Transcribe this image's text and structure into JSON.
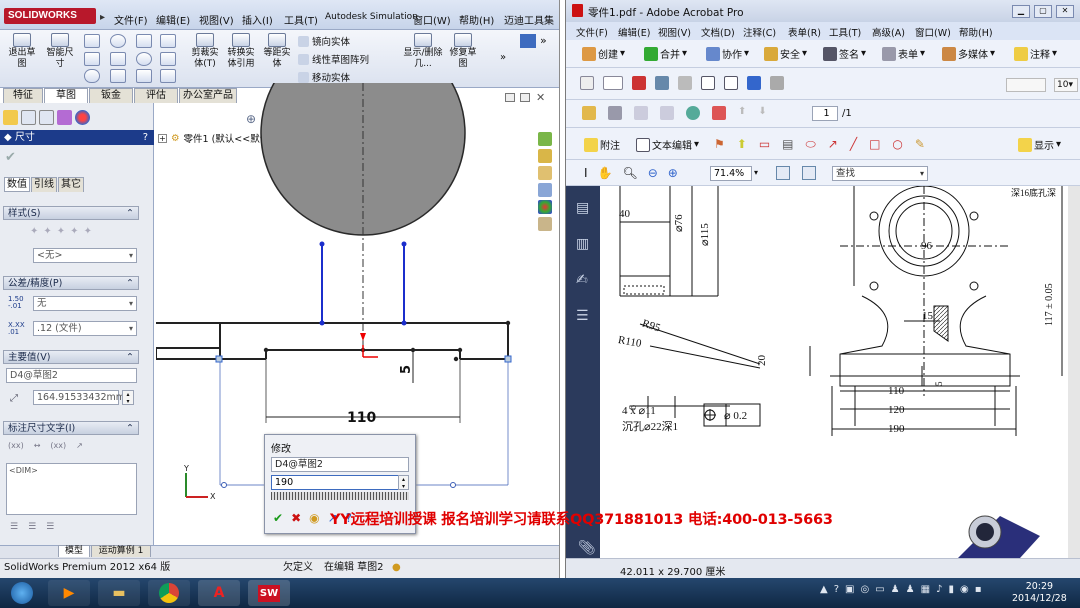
{
  "sw": {
    "app_name": "SOLIDWORKS",
    "menu": [
      "文件(F)",
      "编辑(E)",
      "视图(V)",
      "插入(I)",
      "工具(T)",
      "Autodesk Simulation",
      "窗口(W)",
      "帮助(H)",
      "迈迪工具集"
    ],
    "tools": {
      "exit_sketch": "退出草图",
      "smart_dim": "智能尺寸",
      "trim": "剪裁实体(T)",
      "convert": "转换实体引用",
      "offset": "等距实体",
      "mirror": "镜向实体",
      "linear_pattern": "线性草图阵列",
      "move": "移动实体",
      "show_delete": "显示/删除几...",
      "repair": "修复草图"
    },
    "tabs": [
      "特征",
      "草图",
      "钣金",
      "评估",
      "办公室产品"
    ],
    "tree_item": "零件1 (默认<<默认>_外...",
    "pm": {
      "title": "尺寸",
      "help": "?",
      "subtabs": [
        "数值",
        "引线",
        "其它"
      ],
      "style_label": "样式(S)",
      "style_value": "<无>",
      "tolerance_label": "公差/精度(P)",
      "tolerance_value": "无",
      "precision_value": ".12 (文件)",
      "primary_label": "主要值(V)",
      "primary_name": "D4@草图2",
      "primary_value": "164.91533432mm",
      "dimtext_label": "标注尺寸文字(I)",
      "dimtext_value": "<DIM>"
    },
    "dims": {
      "d5": "5",
      "d110": "110"
    },
    "modify": {
      "title": "修改",
      "name": "D4@草图2",
      "value": "190"
    },
    "bottom_tabs": [
      "模型",
      "运动算例 1"
    ],
    "status": [
      "SolidWorks Premium 2012 x64 版",
      "欠定义",
      "在编辑 草图2"
    ]
  },
  "acro": {
    "title": "零件1.pdf - Adobe Acrobat Pro",
    "menu": [
      "文件(F)",
      "编辑(E)",
      "视图(V)",
      "文档(D)",
      "注释(C)",
      "表单(R)",
      "工具(T)",
      "高级(A)",
      "窗口(W)",
      "帮助(H)"
    ],
    "tb1": [
      "创建",
      "合并",
      "协作",
      "安全",
      "签名",
      "表单",
      "多媒体",
      "注释"
    ],
    "page_current": "1",
    "page_total": "/1",
    "tb3": {
      "annotate": "附注",
      "text_edit": "文本编辑",
      "show": "显示"
    },
    "zoom": "71.4%",
    "search_placeholder": "查找",
    "status_size": "42.011 x 29.700 厘米",
    "drawing": {
      "d40": "40",
      "d76": "⌀76",
      "d115": "⌀115",
      "d96": "96",
      "d117": "117 ± 0.05",
      "d15": "15",
      "r95": "R95",
      "r110": "R110",
      "d20": "20",
      "d6": "6",
      "holes": "4 x ⌀11",
      "counterbore": "沉孔⌀22深1",
      "pos_tol": "⌀ 0.2",
      "d5": "5",
      "d110": "110",
      "d120": "120",
      "d190": "190",
      "top_note": "深16底孔深"
    }
  },
  "watermark": "YY远程培训授课 报名培训学习请联系QQ371881013   电话:400-013-5663",
  "taskbar": {
    "time": "20:29",
    "date": "2014/12/28"
  },
  "colors": {
    "sw_blue": "#1c3b8a",
    "xp_title": "#0a246a",
    "acro_bar": "#dbe4f5",
    "watermark_red": "#e00000"
  }
}
